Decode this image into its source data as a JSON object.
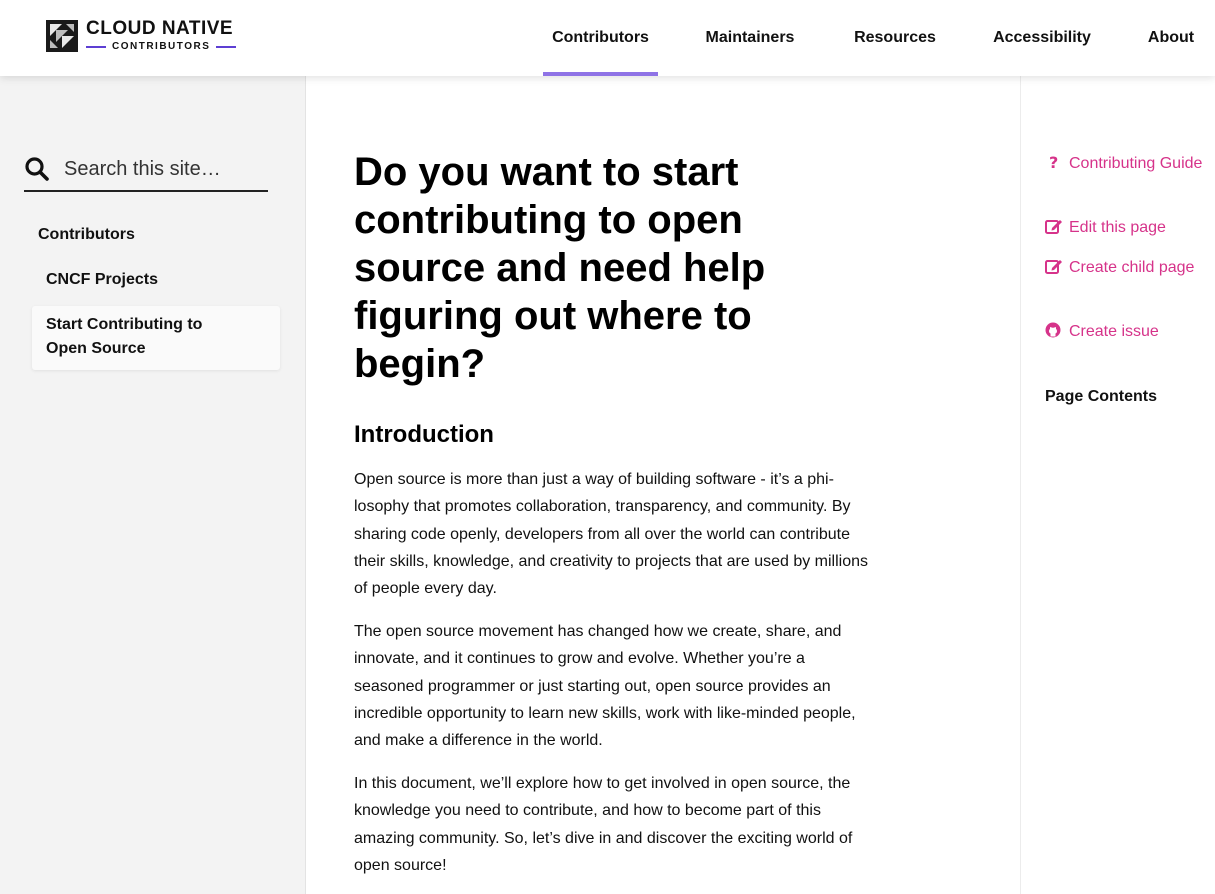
{
  "logo": {
    "line1": "CLOUD NATIVE",
    "line2": "CONTRIBUTORS"
  },
  "nav": [
    {
      "label": "Contributors",
      "active": true
    },
    {
      "label": "Maintainers"
    },
    {
      "label": "Resources"
    },
    {
      "label": "Accessibility"
    },
    {
      "label": "About"
    }
  ],
  "search": {
    "placeholder": "Search this site…"
  },
  "sidebar": {
    "section": "Contributors",
    "items": [
      {
        "label": "CNCF Projects"
      },
      {
        "label": "Start Contributing to Open Source",
        "active": true
      }
    ]
  },
  "main": {
    "title": "Do you want to start contributing to open source and need help figuring out where to begin?",
    "intro_heading": "Introduction",
    "paragraphs": [
      "Open source is more than just a way of building software - it’s a phi­losophy that promotes collaboration, transparency, and community. By sharing code openly, developers from all over the world can con­tribute their skills, knowledge, and creativity to projects that are used by millions of people every day.",
      "The open source movement has changed how we create, share, and innovate, and it continues to grow and evolve. Whether you’re a seasoned programmer or just starting out, open source provides an incredible opportunity to learn new skills, work with like-minded people, and make a difference in the world.",
      "In this document, we’ll explore how to get involved in open source, the knowledge you need to contribute, and how to become part of this amazing community. So, let’s dive in and discover the exciting world of open source!"
    ]
  },
  "right": {
    "links": [
      {
        "label": "Contributing Guide",
        "icon": "question-icon"
      },
      {
        "label": "Edit this page",
        "icon": "edit-icon"
      },
      {
        "label": "Create child page",
        "icon": "edit-icon"
      },
      {
        "label": "Create issue",
        "icon": "github-icon"
      }
    ],
    "page_contents": "Page Contents"
  },
  "colors": {
    "accent": "#d6338a",
    "nav_underline": "#8f73e6",
    "logo_dash": "#5d3fd3"
  }
}
